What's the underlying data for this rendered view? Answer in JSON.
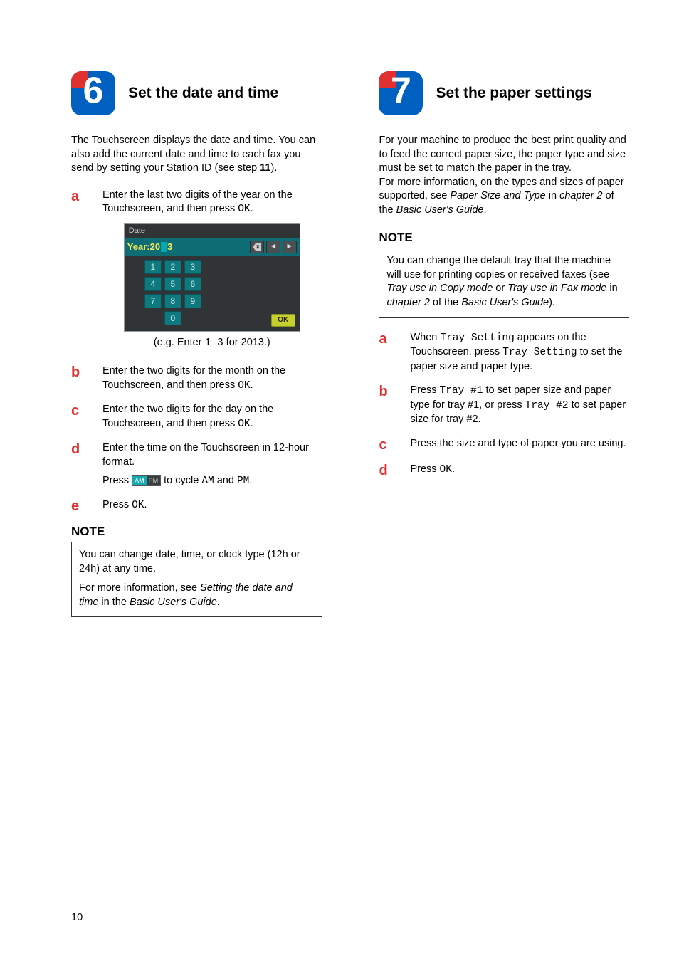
{
  "page_number": "10",
  "left": {
    "step_number": "6",
    "title": "Set the date and time",
    "intro_pre": "The Touchscreen displays the date and time. You can also add the current date and time to each fax you send by setting your Station ID (see step ",
    "intro_step_ref": "11",
    "intro_post": ").",
    "a": {
      "letter": "a",
      "text_pre": "Enter the last two digits of the year on the Touchscreen, and then press ",
      "ok": "OK",
      "text_post": "."
    },
    "screen": {
      "title": "Date",
      "year_label": "Year:20",
      "year_suffix": "3",
      "keys_r1": [
        "1",
        "2",
        "3"
      ],
      "keys_r2": [
        "4",
        "5",
        "6"
      ],
      "keys_r3": [
        "7",
        "8",
        "9"
      ],
      "key_zero": "0",
      "ok": "OK"
    },
    "caption_pre": "(e.g. Enter ",
    "caption_mono": "1 3",
    "caption_post": " for 2013.)",
    "b": {
      "letter": "b",
      "text_pre": "Enter the two digits for the month on the Touchscreen, and then press ",
      "ok": "OK",
      "text_post": "."
    },
    "c": {
      "letter": "c",
      "text_pre": "Enter the two digits for the day on the Touchscreen, and then press ",
      "ok": "OK",
      "text_post": "."
    },
    "d": {
      "letter": "d",
      "line1": "Enter the time on the Touchscreen in 12-hour format.",
      "line2_pre": "Press ",
      "am": "AM",
      "pm": "PM",
      "line2_mid": " to cycle ",
      "line2_am": "AM",
      "line2_and": " and ",
      "line2_pm": "PM",
      "line2_post": "."
    },
    "e": {
      "letter": "e",
      "text_pre": "Press ",
      "ok": "OK",
      "text_post": "."
    },
    "note_title": "NOTE",
    "note_p1": "You can change date, time, or clock type (12h or 24h) at any time.",
    "note_p2_pre": "For more information, see ",
    "note_p2_em": "Setting the date and time",
    "note_p2_mid": " in the ",
    "note_p2_em2": "Basic User's Guide",
    "note_p2_post": "."
  },
  "right": {
    "step_number": "7",
    "title": "Set the paper settings",
    "intro1": "For your machine to produce the best print quality and to feed the correct paper size, the paper type and size must be set to match the paper in the tray.",
    "intro2_pre": "For more information, on the types and sizes of paper supported, see ",
    "intro2_em1": "Paper Size and Type",
    "intro2_mid": " in ",
    "intro2_em2": "chapter 2",
    "intro2_mid2": " of the ",
    "intro2_em3": "Basic User's Guide",
    "intro2_post": ".",
    "note_title": "NOTE",
    "note_p_pre": "You can change the default tray that the machine will use for printing copies or received faxes (see ",
    "note_em1": "Tray use in Copy mode",
    "note_or": " or ",
    "note_em2": "Tray use in Fax mode",
    "note_mid": " in ",
    "note_em3": "chapter 2",
    "note_mid2": " of the ",
    "note_em4": "Basic User's Guide",
    "note_post": ").",
    "a": {
      "letter": "a",
      "pre": "When ",
      "m1": "Tray Setting",
      "mid": " appears on the Touchscreen, press ",
      "m2": "Tray Setting",
      "post": " to set the paper size and paper type."
    },
    "b": {
      "letter": "b",
      "pre": "Press ",
      "m1": "Tray #1",
      "mid": " to set paper size and paper type for tray #1, or press ",
      "m2": "Tray #2",
      "post": " to set paper size for tray #2."
    },
    "c": {
      "letter": "c",
      "text": "Press the size and type of paper you are using."
    },
    "d": {
      "letter": "d",
      "pre": "Press ",
      "ok": "OK",
      "post": "."
    }
  }
}
